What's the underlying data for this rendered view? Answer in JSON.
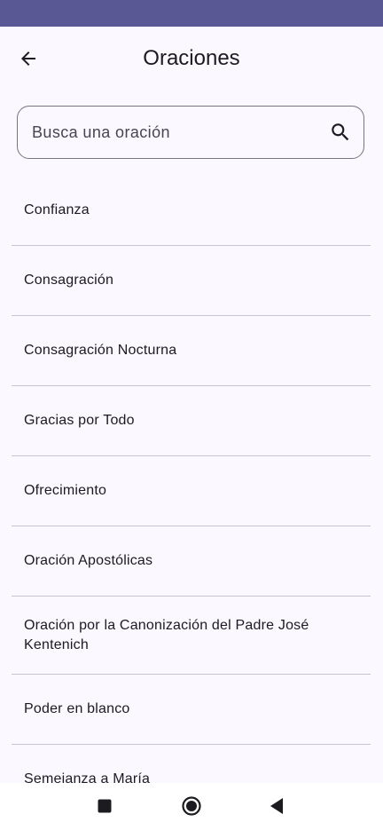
{
  "header": {
    "title": "Oraciones",
    "back_icon": "arrow-left-icon"
  },
  "search": {
    "placeholder": "Busca una oración",
    "value": "",
    "icon": "search-icon"
  },
  "prayers": [
    {
      "label": "Confianza"
    },
    {
      "label": "Consagración"
    },
    {
      "label": "Consagración Nocturna"
    },
    {
      "label": "Gracias por Todo"
    },
    {
      "label": "Ofrecimiento"
    },
    {
      "label": "Oración Apostólicas"
    },
    {
      "label": "Oración por la Canonización del Padre José Kentenich"
    },
    {
      "label": "Poder en blanco"
    },
    {
      "label": "Semejanza a María"
    }
  ],
  "navigation": {
    "recents_icon": "square-icon",
    "home_icon": "circle-home-icon",
    "back_icon": "triangle-back-icon"
  },
  "colors": {
    "status_bar": "#5a5894",
    "background": "#fbf8ff",
    "divider": "#cac4d0",
    "text": "#1c1b1f"
  }
}
